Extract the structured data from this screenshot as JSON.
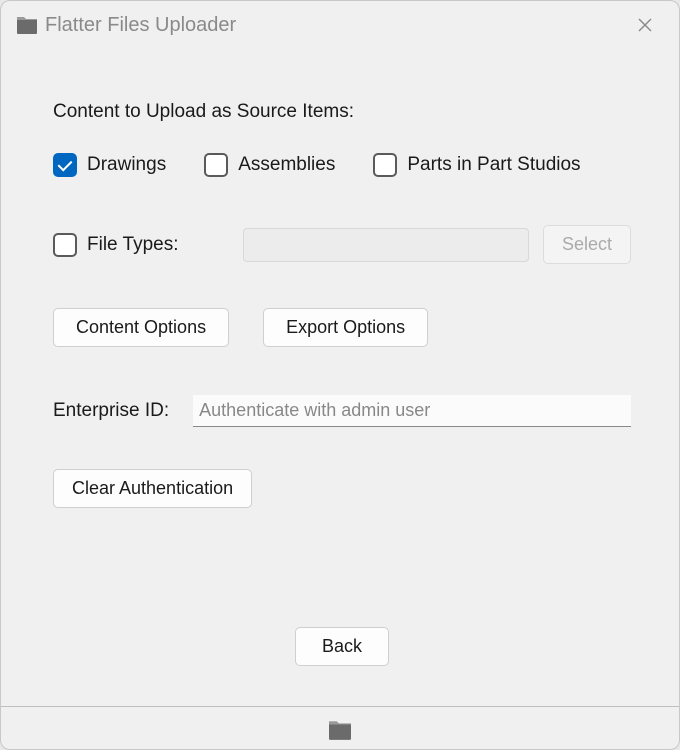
{
  "titlebar": {
    "title": "Flatter Files Uploader"
  },
  "content": {
    "section_label": "Content to Upload as Source Items:",
    "checkboxes": {
      "drawings": {
        "label": "Drawings",
        "checked": true
      },
      "assemblies": {
        "label": "Assemblies",
        "checked": false
      },
      "parts": {
        "label": "Parts in Part Studios",
        "checked": false
      }
    },
    "filetypes": {
      "label": "File Types:",
      "checked": false,
      "value": "",
      "select_label": "Select"
    },
    "buttons": {
      "content_options": "Content Options",
      "export_options": "Export Options",
      "clear_auth": "Clear Authentication",
      "back": "Back"
    },
    "enterprise": {
      "label": "Enterprise ID:",
      "placeholder": "Authenticate with admin user",
      "value": ""
    }
  }
}
